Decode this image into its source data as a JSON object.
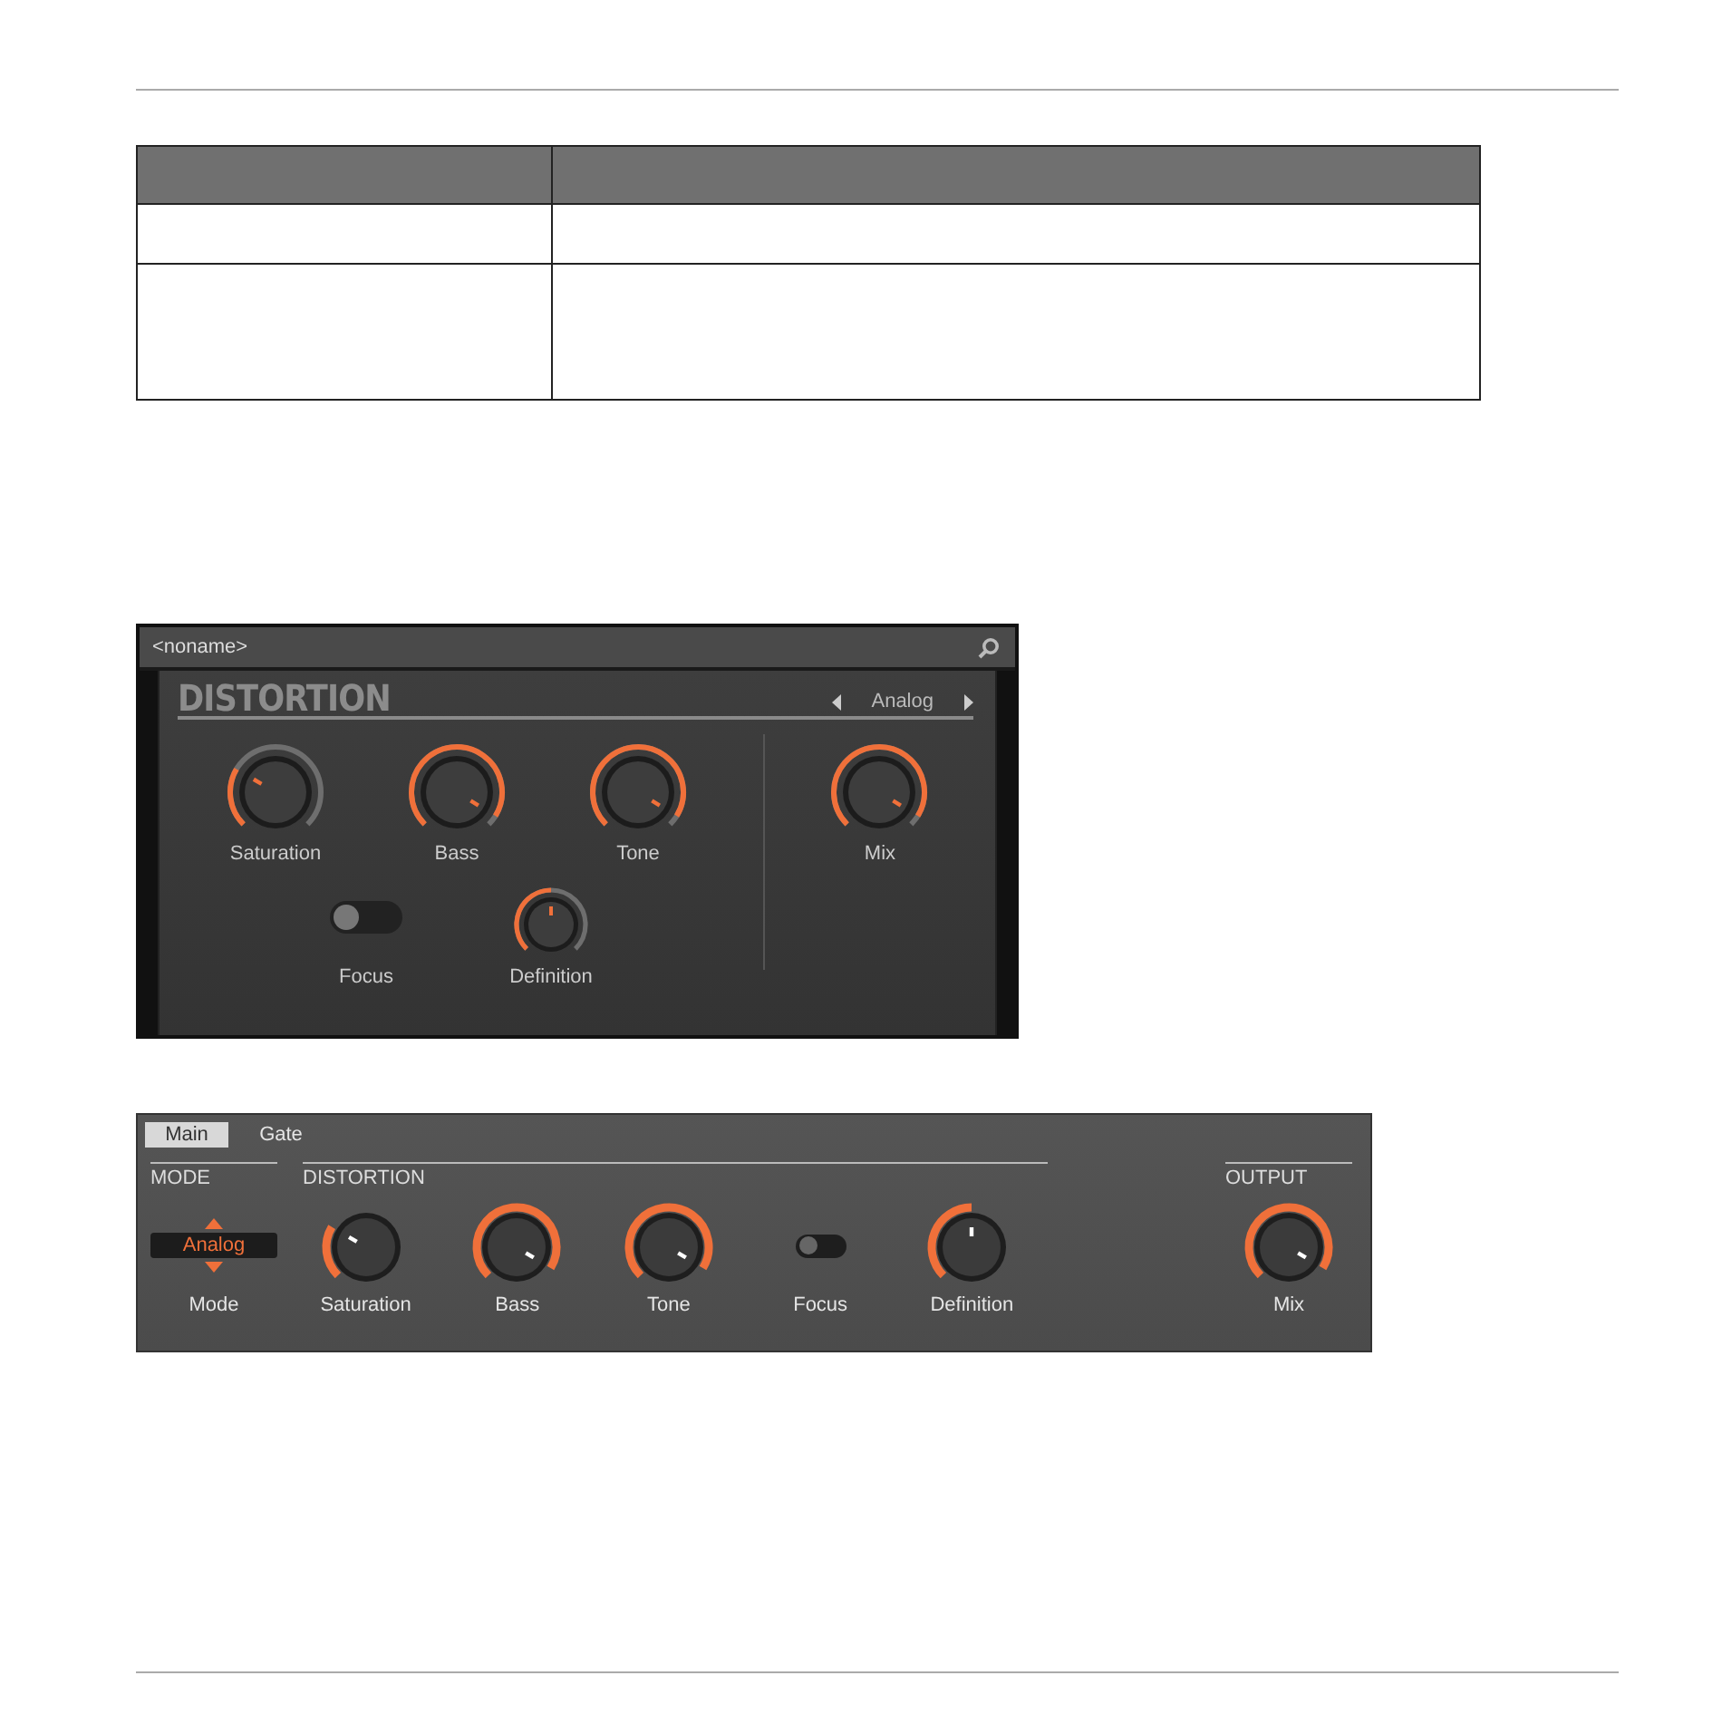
{
  "plugin_panel": {
    "preset_name": "<noname>",
    "title": "DISTORTION",
    "mode": "Analog",
    "upper_controls": [
      {
        "kind": "knob",
        "label": "Saturation"
      },
      {
        "kind": "knob",
        "label": "Bass"
      },
      {
        "kind": "knob",
        "label": "Tone"
      }
    ],
    "lower_controls": [
      {
        "kind": "toggle",
        "label": "Focus",
        "on": false
      },
      {
        "kind": "knob",
        "label": "Definition"
      }
    ],
    "output_controls": [
      {
        "kind": "knob",
        "label": "Mix"
      }
    ]
  },
  "controller_panel": {
    "tabs": [
      {
        "label": "Main",
        "selected": true
      },
      {
        "label": "Gate",
        "selected": false
      }
    ],
    "sections": [
      {
        "title": "MODE",
        "controls": [
          {
            "kind": "selector",
            "label": "Mode",
            "value": "Analog"
          }
        ]
      },
      {
        "title": "DISTORTION",
        "controls": [
          {
            "kind": "knob",
            "label": "Saturation"
          },
          {
            "kind": "knob",
            "label": "Bass"
          },
          {
            "kind": "knob",
            "label": "Tone"
          },
          {
            "kind": "toggle",
            "label": "Focus",
            "on": false
          },
          {
            "kind": "knob",
            "label": "Definition"
          }
        ]
      },
      {
        "title": "OUTPUT",
        "controls": [
          {
            "kind": "knob",
            "label": "Mix"
          }
        ]
      }
    ]
  }
}
